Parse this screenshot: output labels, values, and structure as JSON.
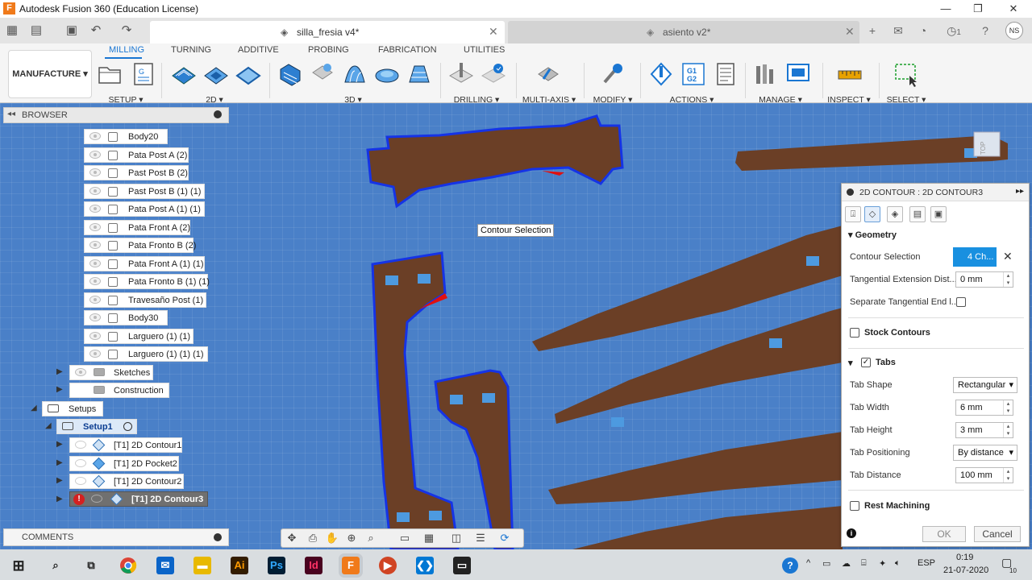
{
  "window": {
    "app_title": "Autodesk Fusion 360 (Education License)",
    "app_glyph": "F",
    "minimize": "—",
    "maximize": "❐",
    "close": "✕"
  },
  "doc_tabs": [
    {
      "name": "silla_fresia v4*",
      "active": true
    },
    {
      "name": "asiento v2*",
      "active": false
    }
  ],
  "tab_close": "✕",
  "tab_add": "+",
  "user_initials": "NS",
  "job_count": "1",
  "workspace": {
    "label": "MANUFACTURE ▾"
  },
  "ribbon_tabs": [
    "MILLING",
    "TURNING",
    "ADDITIVE",
    "PROBING",
    "FABRICATION",
    "UTILITIES"
  ],
  "ribbon_groups": [
    "SETUP ▾",
    "2D ▾",
    "3D ▾",
    "DRILLING ▾",
    "MULTI-AXIS ▾",
    "MODIFY ▾",
    "ACTIONS ▾",
    "MANAGE ▾",
    "INSPECT ▾",
    "SELECT ▾"
  ],
  "actions_g1g2": [
    "G1",
    "G2"
  ],
  "browser": {
    "title": "BROWSER",
    "bodies": [
      "Body20",
      "Pata Post A (2)",
      "Past Post B (2)",
      "Past Post B (1) (1)",
      "Pata Post A (1) (1)",
      "Pata Front A (2)",
      "Pata Fronto B (2)",
      "Pata Front A (1) (1)",
      "Pata Fronto B (1) (1)",
      "Travesaño Post (1)",
      "Body30",
      "Larguero (1) (1)",
      "Larguero (1) (1) (1)"
    ],
    "folders": [
      "Sketches",
      "Construction"
    ],
    "setups_label": "Setups",
    "setup1_label": "Setup1",
    "operations": [
      "[T1] 2D Contour1",
      "[T1] 2D Pocket2",
      "[T1] 2D Contour2",
      "[T1] 2D Contour3"
    ],
    "error_glyph": "!"
  },
  "comments_label": "COMMENTS",
  "tooltip": "Contour Selection",
  "viewcube_label": "TOP",
  "panel": {
    "title": "2D CONTOUR : 2D CONTOUR3",
    "geometry": "Geometry",
    "contour_selection": "Contour Selection",
    "contour_selection_value": "4 Ch...",
    "tangential_ext": "Tangential Extension Dist...",
    "tangential_ext_value": "0 mm",
    "separate_tangential": "Separate Tangential End l...",
    "stock_contours": "Stock Contours",
    "tabs": "Tabs",
    "tab_shape": "Tab Shape",
    "tab_shape_value": "Rectangular",
    "tab_width": "Tab Width",
    "tab_width_value": "6 mm",
    "tab_height": "Tab Height",
    "tab_height_value": "3 mm",
    "tab_positioning": "Tab Positioning",
    "tab_positioning_value": "By distance",
    "tab_distance": "Tab Distance",
    "tab_distance_value": "100 mm",
    "rest_machining": "Rest Machining",
    "ok": "OK",
    "cancel": "Cancel",
    "info_glyph": "i"
  },
  "taskbar": {
    "apps": [
      "Ai",
      "Ps",
      "Id",
      "F"
    ],
    "language": "ESP",
    "time": "0:19",
    "date": "21-07-2020",
    "notif_count": "10"
  },
  "colors": {
    "accent": "#1a76d2",
    "selection": "#1533e6",
    "wood": "#6b3f26",
    "error": "#d42020"
  }
}
